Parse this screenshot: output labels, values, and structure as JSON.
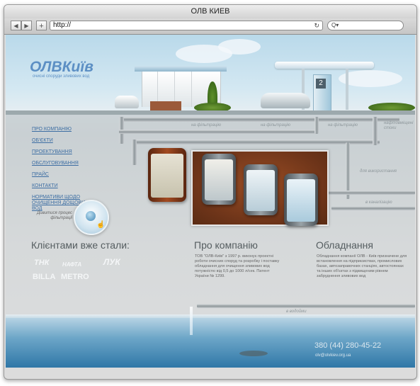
{
  "window": {
    "title": "ОЛВ КИЕВ"
  },
  "toolbar": {
    "back_label": "◀",
    "forward_label": "▶",
    "add_label": "+",
    "url": "http://",
    "reload_label": "↻",
    "search_label": "Q▾"
  },
  "site": {
    "logo_title": "ОЛВКиїв",
    "logo_subtitle": "очисні споруди зливових вод",
    "station_sign": "2",
    "nav": [
      "ПРО КОМПАНІЮ",
      "ОБ'ЄКТИ",
      "ПРОЕКТУВАННЯ",
      "ОБСЛУГОВУВАННЯ",
      "ПРАЙС",
      "КОНТАКТИ",
      "НОРМАТИВИ ЩОДО ОЧИЩЕННЯ ДОЩОВИХ ВОД"
    ],
    "pipe_labels": {
      "filter1": "на фільтрацію",
      "filter2": "на фільтрацію",
      "filter3": "на фільтрацію",
      "oily": "нафтовміщені стоки",
      "reuse": "для використання",
      "sewer": "в каналізацію",
      "outflow": "в водойми"
    },
    "view_filtering": "Дивитися процес фільтрації",
    "clients": {
      "heading": "Клієнтами вже стали:",
      "logos": [
        "ТНК",
        "НАФТА",
        "ЛУК",
        "BILLA",
        "METRO"
      ]
    },
    "about": {
      "heading": "Про компанію",
      "text": "ТОВ \"ОЛВ-Київ\" з 1997 р. виконує проектні роботи очисних споруд та розробку і поставку обладнання для очищення зливових вод потужністю від 0,5 до 1000 л/сек. Патент України № 1299."
    },
    "equipment": {
      "heading": "Обладнання",
      "text": "Обладнання компанії ОЛВ - Київ призначене для встановлення на підприємствах, промислових базах, автозаправочних станціях, автостоянках та інших об'єктах з підвищеним рівнем забруднення зливових вод"
    },
    "contact": {
      "phone": "380 (44) 280-45-22",
      "email": "olv@olvkiev.org.ua"
    }
  },
  "colors": {
    "accent": "#3d6ea3",
    "water": "#2f77a7"
  }
}
